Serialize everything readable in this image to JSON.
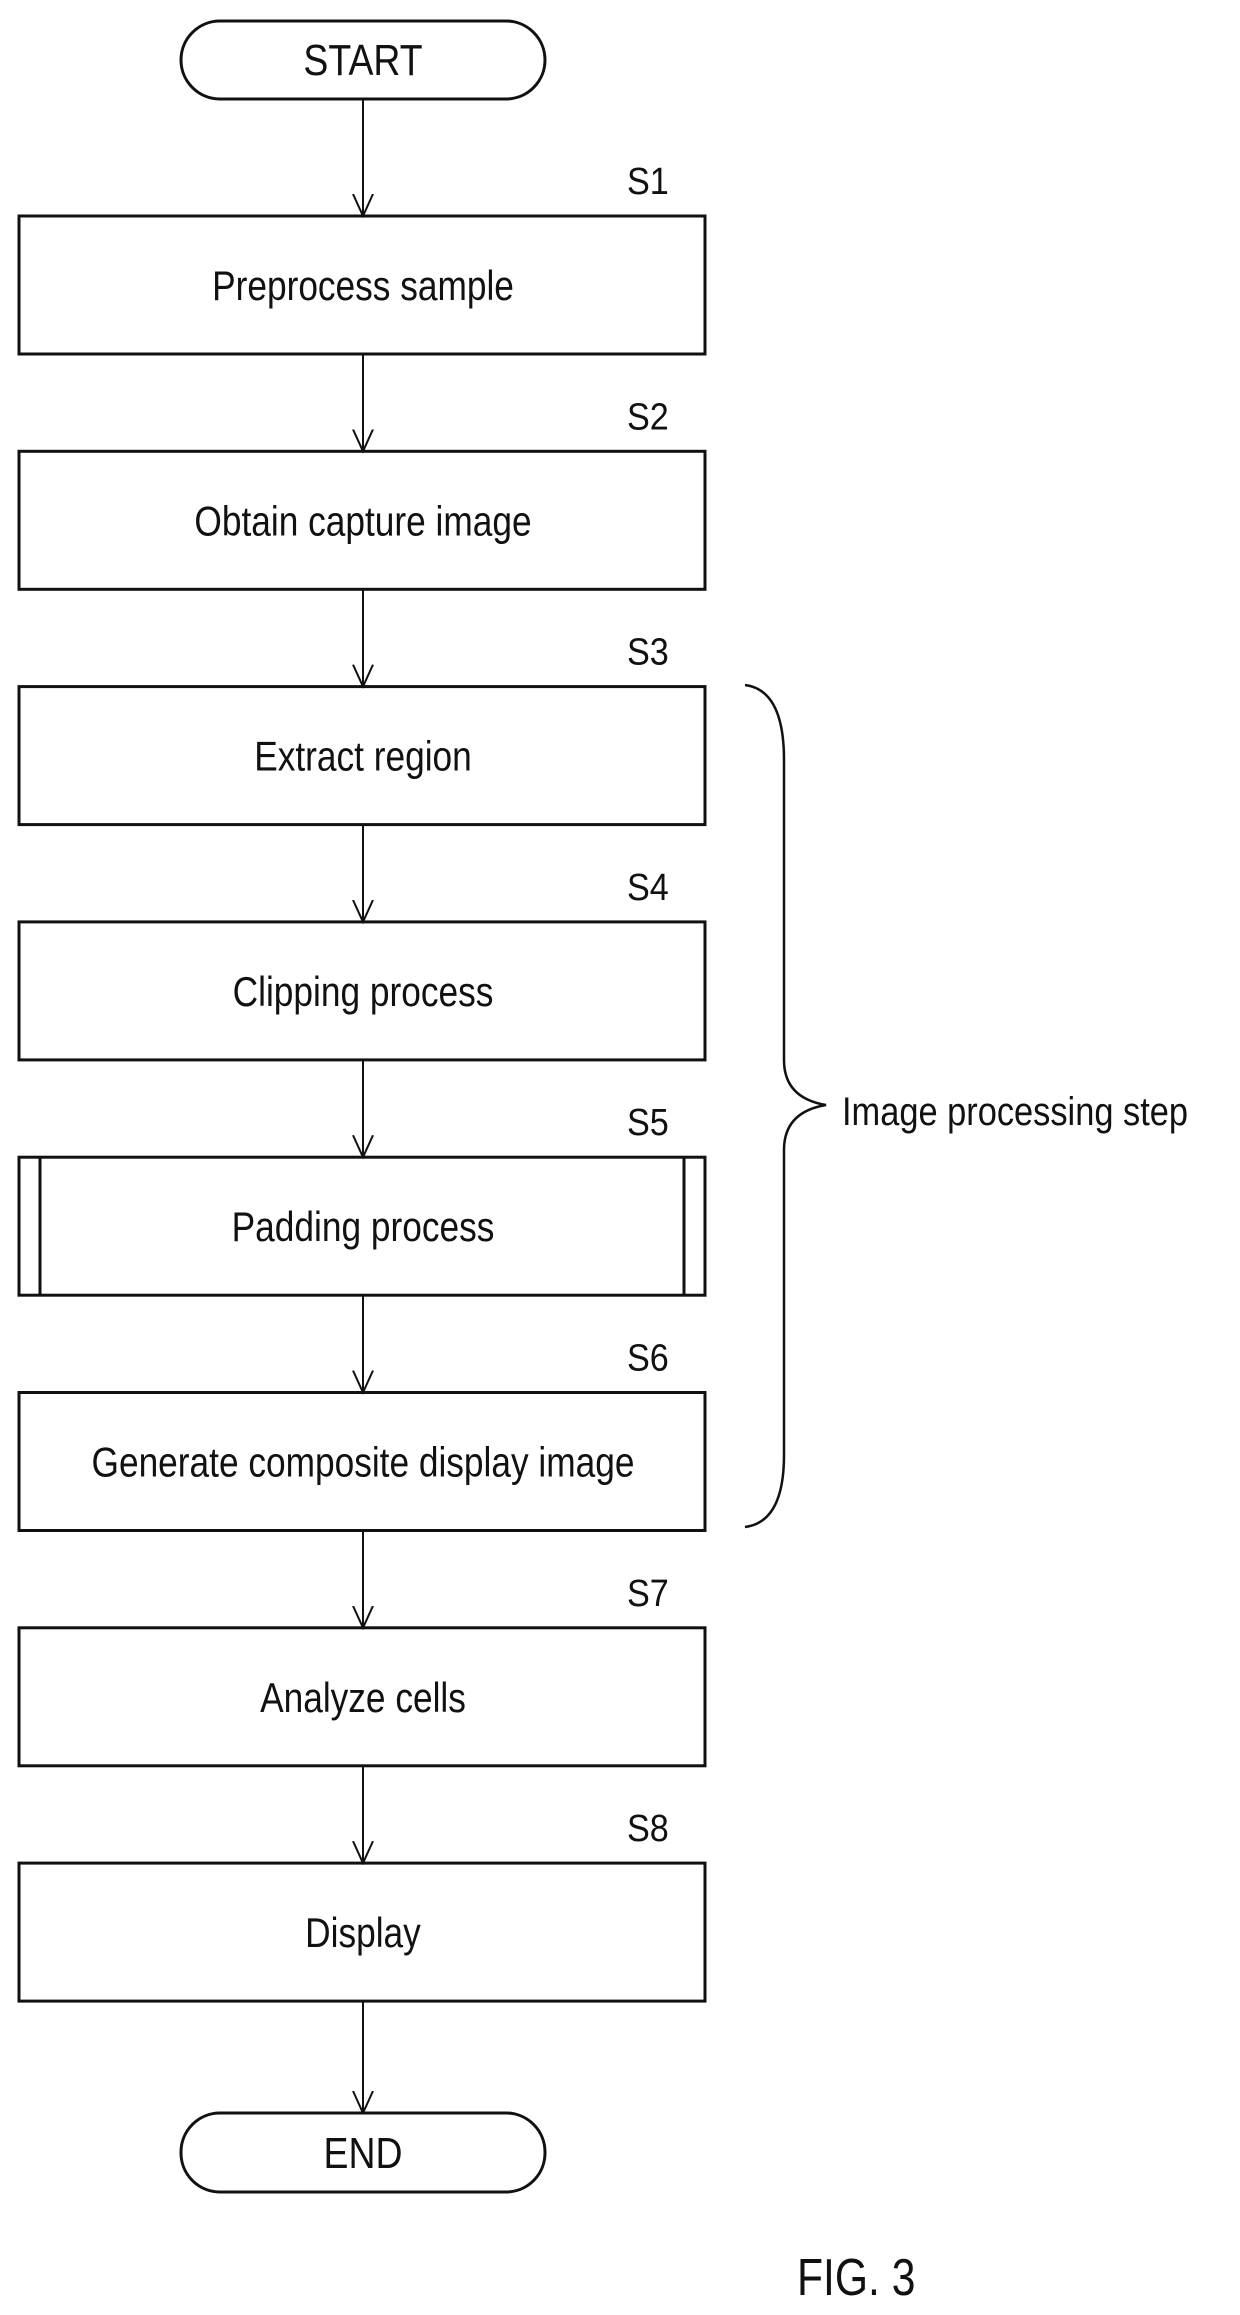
{
  "figure_label": "FIG. 3",
  "terminals": {
    "start": "START",
    "end": "END"
  },
  "steps": [
    {
      "id": "S1",
      "label": "Preprocess sample",
      "type": "process"
    },
    {
      "id": "S2",
      "label": "Obtain capture image",
      "type": "process"
    },
    {
      "id": "S3",
      "label": "Extract region",
      "type": "process"
    },
    {
      "id": "S4",
      "label": "Clipping process",
      "type": "process"
    },
    {
      "id": "S5",
      "label": "Padding process",
      "type": "subroutine"
    },
    {
      "id": "S6",
      "label": "Generate composite display image",
      "type": "process"
    },
    {
      "id": "S7",
      "label": "Analyze cells",
      "type": "process"
    },
    {
      "id": "S8",
      "label": "Display",
      "type": "process"
    }
  ],
  "group": {
    "label": "Image processing step",
    "from_step": "S3",
    "to_step": "S6"
  }
}
